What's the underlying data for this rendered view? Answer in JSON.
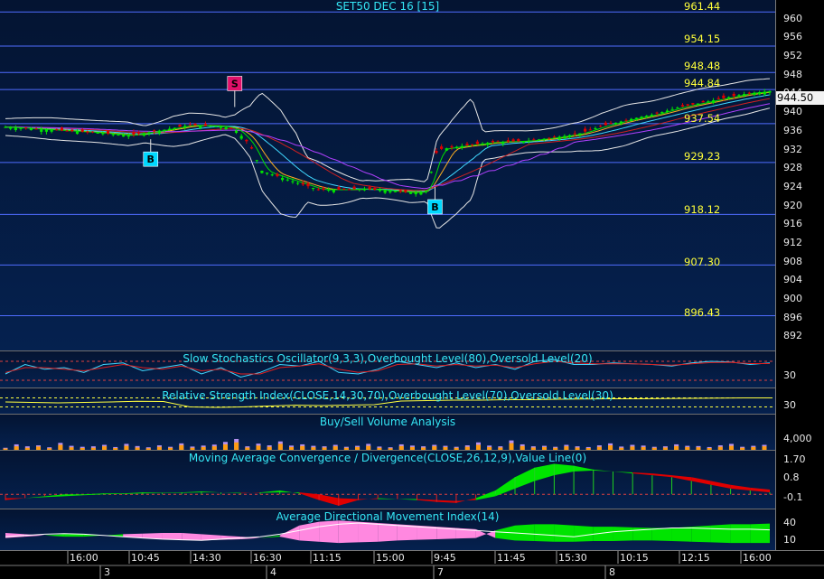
{
  "chart_data": [
    {
      "type": "candlestick",
      "title": "SET50 DEC 16  [15]",
      "ylim": [
        889,
        964
      ],
      "y_ticks": [
        960,
        956,
        952,
        948,
        944,
        940,
        936,
        932,
        928,
        924,
        920,
        916,
        912,
        908,
        904,
        900,
        896,
        892
      ],
      "last_price": "944.50",
      "levels": [
        "961.44",
        "954.15",
        "948.48",
        "944.84",
        "937.54",
        "929.23",
        "918.12",
        "907.30",
        "896.43"
      ],
      "level_values": [
        961.44,
        954.15,
        948.48,
        944.84,
        937.54,
        929.23,
        918.12,
        907.3,
        896.43
      ],
      "signals": [
        {
          "label": "B",
          "x": 0.19,
          "price": 934.2,
          "type": "buy"
        },
        {
          "label": "S",
          "x": 0.3,
          "price": 941.1,
          "type": "sell"
        },
        {
          "label": "B",
          "x": 0.562,
          "price": 924.0,
          "type": "buy"
        }
      ],
      "close_path": [
        [
          0.0,
          936.8
        ],
        [
          0.04,
          936.4
        ],
        [
          0.08,
          936.0
        ],
        [
          0.12,
          935.6
        ],
        [
          0.16,
          935.0
        ],
        [
          0.2,
          936.0
        ],
        [
          0.24,
          937.2
        ],
        [
          0.28,
          937.0
        ],
        [
          0.3,
          936.4
        ],
        [
          0.32,
          933.0
        ],
        [
          0.335,
          927.5
        ],
        [
          0.35,
          926.6
        ],
        [
          0.38,
          925.0
        ],
        [
          0.41,
          923.4
        ],
        [
          0.44,
          923.4
        ],
        [
          0.47,
          923.6
        ],
        [
          0.5,
          923.2
        ],
        [
          0.53,
          922.8
        ],
        [
          0.55,
          923.0
        ],
        [
          0.565,
          932.0
        ],
        [
          0.6,
          932.8
        ],
        [
          0.64,
          933.6
        ],
        [
          0.68,
          933.8
        ],
        [
          0.72,
          934.6
        ],
        [
          0.75,
          935.4
        ],
        [
          0.78,
          937.0
        ],
        [
          0.82,
          938.6
        ],
        [
          0.85,
          939.6
        ],
        [
          0.88,
          941.0
        ],
        [
          0.91,
          942.0
        ],
        [
          0.94,
          943.0
        ],
        [
          0.97,
          944.0
        ],
        [
          1.0,
          944.5
        ]
      ]
    },
    {
      "type": "line",
      "title": "Slow Stochastics Oscillator(9,3,3),Overbought Level(80),Oversold Level(20)",
      "y_ticks": [
        30
      ],
      "ylim": [
        0,
        100
      ],
      "overbought": 80,
      "oversold": 20,
      "series": [
        {
          "values": [
            40,
            70,
            55,
            60,
            45,
            70,
            75,
            50,
            60,
            70,
            40,
            60,
            30,
            45,
            70,
            65,
            80,
            45,
            40,
            55,
            80,
            70,
            60,
            75,
            60,
            70,
            55,
            80,
            85,
            70,
            70,
            75,
            72,
            70,
            65,
            75,
            80,
            78,
            70,
            75
          ]
        },
        {
          "values": [
            45,
            60,
            60,
            55,
            50,
            60,
            70,
            60,
            55,
            65,
            50,
            55,
            40,
            40,
            60,
            65,
            72,
            55,
            45,
            50,
            70,
            72,
            65,
            70,
            65,
            68,
            60,
            72,
            80,
            75,
            72,
            72,
            72,
            70,
            68,
            72,
            76,
            77,
            73,
            73
          ]
        }
      ]
    },
    {
      "type": "line",
      "title": "Relative Strength Index(CLOSE,14,30,70),Overbought Level(70),Oversold Level(30)",
      "y_ticks": [
        30
      ],
      "ylim": [
        0,
        100
      ],
      "overbought": 70,
      "oversold": 30,
      "values": [
        52,
        50,
        48,
        50,
        52,
        55,
        54,
        30,
        28,
        30,
        34,
        38,
        36,
        38,
        40,
        56,
        58,
        60,
        60,
        62,
        62,
        64,
        65,
        66,
        66,
        67,
        68,
        69,
        70,
        70
      ]
    },
    {
      "type": "bar",
      "title": "Buy/Sell Volume Analysis",
      "y_ticks": [
        "4,000"
      ],
      "ylim": [
        0,
        14000
      ],
      "buy": [
        1200,
        2600,
        1800,
        2200,
        1400,
        3200,
        2000,
        1600,
        1800,
        2400,
        1500,
        2800,
        1900,
        1400,
        2200,
        1600,
        3000,
        1700,
        2100,
        2500,
        3600,
        4800,
        1800,
        2900,
        2200,
        3800,
        2100,
        2600,
        2000,
        1800,
        2400,
        1600,
        2000,
        2800,
        1700,
        1400,
        2600,
        2100,
        1800,
        2400,
        2000,
        1600,
        2200,
        3400,
        2100,
        1800,
        4200,
        2600,
        1800,
        2000,
        1600,
        2400,
        1800,
        1500,
        2200,
        3000,
        1700,
        2400,
        2100,
        1600,
        1800,
        2600,
        2000,
        1900,
        1500,
        2200,
        2800,
        1600,
        2000,
        2400
      ],
      "sell": [
        900,
        1800,
        1200,
        1700,
        1000,
        2400,
        1400,
        1100,
        1200,
        1800,
        1100,
        2000,
        1300,
        1000,
        1600,
        1200,
        2300,
        1200,
        1500,
        1800,
        2600,
        3400,
        1300,
        2100,
        1600,
        2800,
        1500,
        1900,
        1400,
        1300,
        1800,
        1200,
        1500,
        2000,
        1200,
        1000,
        1900,
        1500,
        1300,
        1800,
        1500,
        1200,
        1600,
        2400,
        1500,
        1300,
        3100,
        1900,
        1300,
        1500,
        1200,
        1800,
        1300,
        1100,
        1600,
        2200,
        1200,
        1700,
        1500,
        1200,
        1300,
        1900,
        1500,
        1400,
        1100,
        1600,
        2000,
        1200,
        1500,
        1800
      ]
    },
    {
      "type": "area",
      "title": "Moving Average Convergence / Divergence(CLOSE,26,12,9),Value Line(0)",
      "y_ticks": [
        "1.70",
        "0.8",
        "-0.1"
      ],
      "ylim": [
        -0.7,
        2.1
      ],
      "macd": [
        -0.3,
        -0.2,
        -0.1,
        0.0,
        0.0,
        0.05,
        0.05,
        0.1,
        0.08,
        0.1,
        0.15,
        0.1,
        0.05,
        0.1,
        0.2,
        0.05,
        -0.3,
        -0.6,
        -0.3,
        -0.2,
        -0.25,
        -0.3,
        -0.4,
        -0.45,
        -0.2,
        0.2,
        0.9,
        1.4,
        1.6,
        1.5,
        1.3,
        1.2,
        1.1,
        1.0,
        0.9,
        0.7,
        0.5,
        0.3,
        0.2,
        0.1
      ],
      "signal": [
        -0.2,
        -0.2,
        -0.15,
        -0.1,
        -0.05,
        0.0,
        0.02,
        0.05,
        0.06,
        0.08,
        0.1,
        0.1,
        0.08,
        0.08,
        0.1,
        0.1,
        0.0,
        -0.2,
        -0.25,
        -0.25,
        -0.25,
        -0.25,
        -0.3,
        -0.35,
        -0.3,
        -0.1,
        0.3,
        0.7,
        1.0,
        1.2,
        1.25,
        1.2,
        1.15,
        1.1,
        1.0,
        0.9,
        0.7,
        0.5,
        0.35,
        0.25
      ]
    },
    {
      "type": "area",
      "title": "Average Directional Movement Index(14)",
      "y_ticks": [
        "40",
        "10"
      ],
      "ylim": [
        0,
        55
      ],
      "adx": [
        20,
        22,
        24,
        25,
        24,
        22,
        20,
        18,
        16,
        15,
        14,
        16,
        18,
        20,
        24,
        30,
        36,
        40,
        42,
        40,
        38,
        36,
        34,
        32,
        30,
        28,
        26,
        24,
        22,
        20,
        24,
        28,
        30,
        32,
        34,
        34,
        33,
        32,
        32,
        31
      ],
      "plus_di": [
        18,
        20,
        22,
        24,
        24,
        22,
        20,
        18,
        16,
        15,
        14,
        15,
        16,
        18,
        20,
        14,
        12,
        10,
        11,
        12,
        14,
        15,
        16,
        17,
        18,
        30,
        38,
        40,
        40,
        38,
        36,
        36,
        35,
        34,
        34,
        36,
        38,
        40,
        40,
        41
      ],
      "minus_di": [
        26,
        24,
        22,
        20,
        20,
        22,
        24,
        25,
        26,
        26,
        24,
        22,
        20,
        18,
        22,
        38,
        44,
        46,
        44,
        42,
        40,
        38,
        36,
        34,
        32,
        18,
        14,
        13,
        12,
        12,
        13,
        13,
        14,
        14,
        13,
        12,
        11,
        10,
        10,
        10
      ]
    }
  ],
  "x_axis": {
    "time_labels": [
      "16:00",
      "10:45",
      "14:30",
      "16:30",
      "11:15",
      "15:00",
      "9:45",
      "11:45",
      "15:30",
      "10:15",
      "12:15",
      "16:00"
    ],
    "date_labels": [
      "3",
      "4",
      "7",
      "8"
    ]
  },
  "colors": {
    "panel_bg": "#041432",
    "level_line": "#4f6cff",
    "title": "#35e6f5",
    "level_label": "#ffff3a",
    "bull": "#00e400",
    "bear": "#e00000",
    "buy_marker": "#00d8ff",
    "sell_marker": "#e0106a",
    "vol_buy": "#ff9c10",
    "vol_sell": "#b690f0",
    "adx_fill": "#ff88e0"
  }
}
